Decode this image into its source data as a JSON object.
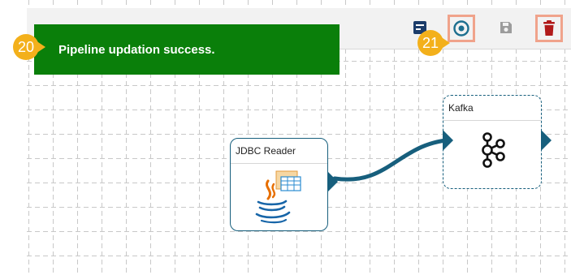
{
  "toast": {
    "message": "Pipeline updation success."
  },
  "callouts": [
    {
      "number": "20"
    },
    {
      "number": "21"
    }
  ],
  "toolbar": {
    "icons": [
      "view-icon",
      "activate-icon",
      "save-icon",
      "delete-icon"
    ],
    "highlighted": [
      "activate",
      "delete"
    ]
  },
  "nodes": {
    "jdbc": {
      "title": "JDBC Reader",
      "icon": "java-icon"
    },
    "kafka": {
      "title": "Kafka",
      "icon": "kafka-icon"
    }
  },
  "colors": {
    "toast_bg": "#0a7f0a",
    "callout": "#f3b01b",
    "highlight_border": "#f0a38b",
    "node_accent": "#175f7d",
    "delete_icon": "#b11a1a",
    "activate_icon": "#1d6f8f"
  }
}
